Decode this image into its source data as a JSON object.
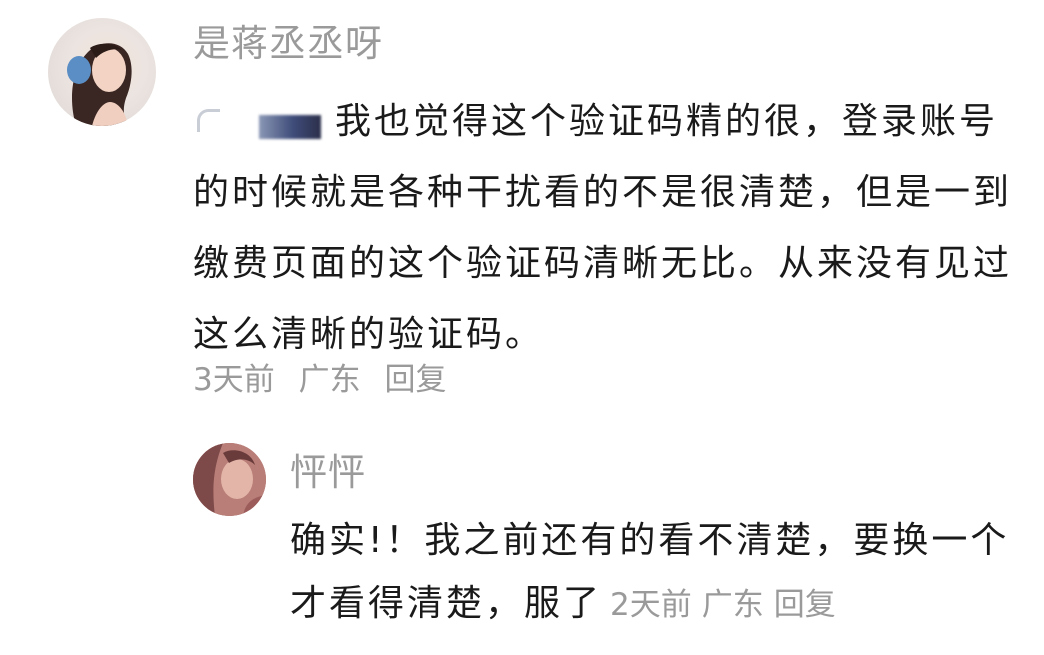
{
  "comment": {
    "avatar_icon": "user-avatar-icon",
    "username": "是蒋丞丞呀",
    "mention_icon": "blurred-mention-icon",
    "text": "我也觉得这个验证码精的很，登录账号的时候就是各种干扰看的不是很清楚，但是一到缴费页面的这个验证码清晰无比。从来没有见过这么清晰的验证码。",
    "time": "3天前",
    "location": "广东",
    "reply_label": "回复"
  },
  "reply": {
    "avatar_icon": "user-avatar-icon",
    "username": "怦怦",
    "text": "确实!！我之前还有的看不清楚，要换一个才看得清楚，服了",
    "time": "2天前",
    "location": "广东",
    "reply_label": "回复"
  },
  "colors": {
    "text": "#1a1a1a",
    "muted": "#9a9a9a",
    "background": "#ffffff"
  }
}
